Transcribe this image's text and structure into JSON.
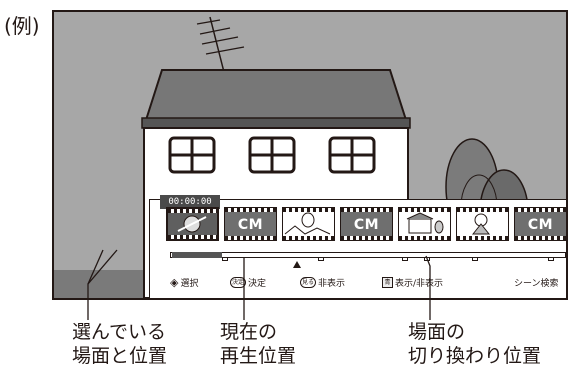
{
  "example_label": "(例)",
  "player": {
    "timecode": "00:00:00",
    "cm_label": "CM",
    "thumbnails": [
      {
        "kind": "scene",
        "name": "thumbnail-fish-selected"
      },
      {
        "kind": "cm"
      },
      {
        "kind": "scene",
        "name": "thumbnail-balloon"
      },
      {
        "kind": "cm"
      },
      {
        "kind": "scene",
        "name": "thumbnail-house"
      },
      {
        "kind": "scene",
        "name": "thumbnail-girl"
      },
      {
        "kind": "cm"
      }
    ],
    "guide": {
      "select": "選択",
      "decide_key": "決定",
      "decide": "決定",
      "view_key": "見る",
      "hide": "非表示",
      "toggle_key": "青",
      "toggle": "表示/非表示",
      "scene_search": "シーン検索"
    }
  },
  "captions": {
    "selected_line1": "選んでいる",
    "selected_line2": "場面と位置",
    "current_line1": "現在の",
    "current_line2": "再生位置",
    "switch_line1": "場面の",
    "switch_line2": "切り換わり位置"
  }
}
